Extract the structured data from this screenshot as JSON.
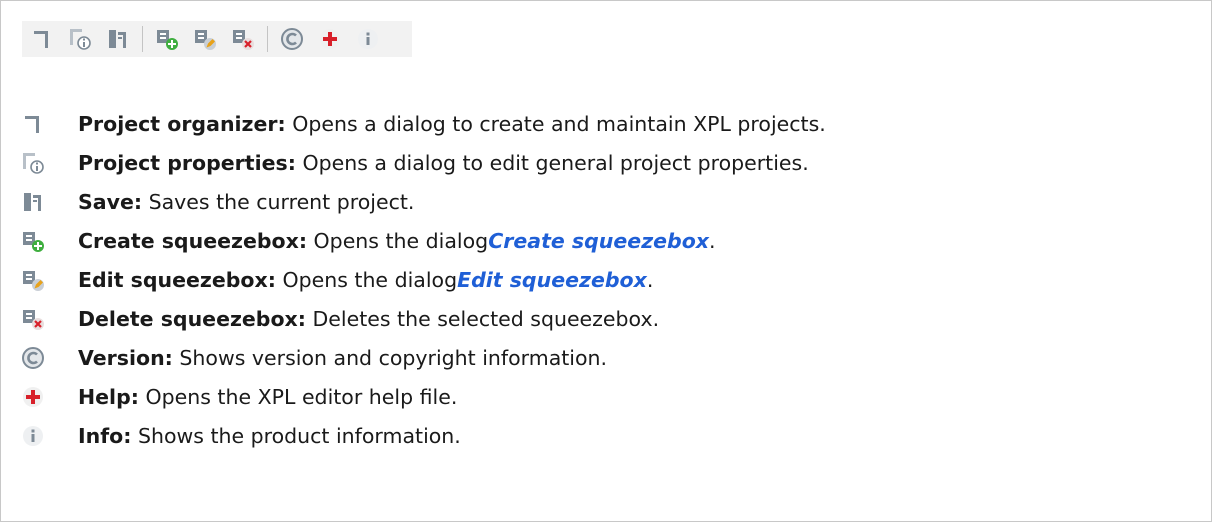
{
  "toolbar": {
    "groups": [
      [
        "project-organizer-icon",
        "project-properties-icon",
        "save-icon"
      ],
      [
        "create-squeezebox-icon",
        "edit-squeezebox-icon",
        "delete-squeezebox-icon"
      ],
      [
        "version-icon",
        "help-icon",
        "info-icon"
      ]
    ]
  },
  "items": [
    {
      "icon": "project-organizer-icon",
      "name": "Project organizer:",
      "text": " Opens a dialog to create and maintain XPL projects.",
      "link": "",
      "tail": ""
    },
    {
      "icon": "project-properties-icon",
      "name": "Project properties:",
      "text": " Opens a dialog to edit general project properties.",
      "link": "",
      "tail": ""
    },
    {
      "icon": "save-icon",
      "name": "Save:",
      "text": " Saves the current project.",
      "link": "",
      "tail": ""
    },
    {
      "icon": "create-squeezebox-icon",
      "name": "Create squeezebox:",
      "text": " Opens the dialog ",
      "link": "Create squeezebox",
      "tail": "."
    },
    {
      "icon": "edit-squeezebox-icon",
      "name": "Edit squeezebox:",
      "text": " Opens the dialog ",
      "link": "Edit squeezebox",
      "tail": "."
    },
    {
      "icon": "delete-squeezebox-icon",
      "name": "Delete squeezebox:",
      "text": " Deletes the selected squeezebox.",
      "link": "",
      "tail": ""
    },
    {
      "icon": "version-icon",
      "name": "Version:",
      "text": " Shows version and copyright information.",
      "link": "",
      "tail": ""
    },
    {
      "icon": "help-icon",
      "name": "Help:",
      "text": " Opens the XPL editor help file.",
      "link": "",
      "tail": ""
    },
    {
      "icon": "info-icon",
      "name": "Info:",
      "text": " Shows the product information.",
      "link": "",
      "tail": ""
    }
  ],
  "colors": {
    "link": "#1f5fd6",
    "toolbar_bg": "#f2f2f2",
    "icon_gray": "#7d8a96",
    "icon_green": "#3fae3f",
    "icon_red": "#d8202a",
    "icon_orange": "#e8a21a"
  }
}
